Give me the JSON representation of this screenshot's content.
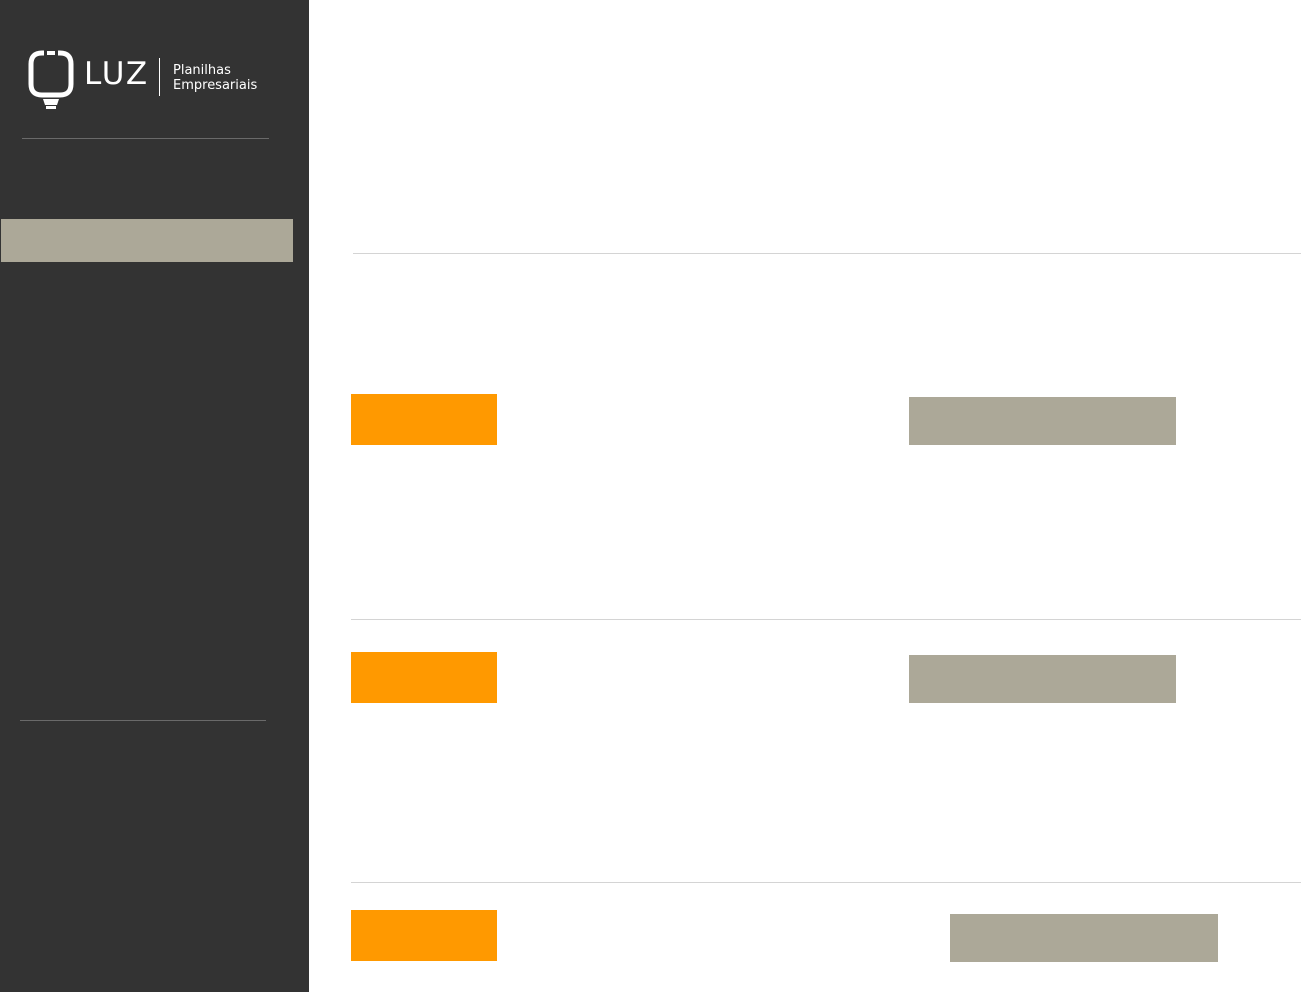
{
  "brand": {
    "wordmark": "LUZ",
    "tagline_line1": "Planilhas",
    "tagline_line2": "Empresariais",
    "logo_icon": "lightbulb-icon"
  },
  "colors": {
    "sidebar_background": "#333333",
    "active_item": "#aca898",
    "accent_orange": "#ff9900",
    "secondary_button": "#aca898",
    "page_background": "#ffffff",
    "divider": "#d4d4d4"
  },
  "sidebar": {
    "active_item_label": ""
  },
  "sections": [
    {
      "primary_label": "",
      "secondary_label": ""
    },
    {
      "primary_label": "",
      "secondary_label": ""
    },
    {
      "primary_label": "",
      "secondary_label": ""
    }
  ]
}
